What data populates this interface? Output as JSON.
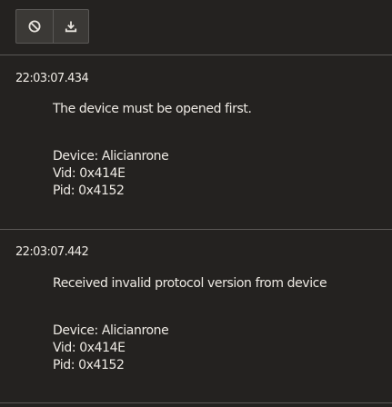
{
  "toolbar": {
    "buttons": [
      {
        "icon": "clear-icon",
        "label": ""
      },
      {
        "icon": "download-icon",
        "label": ""
      }
    ]
  },
  "entries": [
    {
      "timestamp": "22:03:07.434",
      "message": "The device must be opened first.",
      "device": "Device: Alicianrone",
      "vid": "Vid: 0x414E",
      "pid": "Pid: 0x4152"
    },
    {
      "timestamp": "22:03:07.442",
      "message": "Received invalid protocol version from device",
      "device": "Device: Alicianrone",
      "vid": "Vid: 0x414E",
      "pid": "Pid: 0x4152"
    }
  ],
  "colors": {
    "background": "#242220",
    "text": "#eeeae4",
    "divider": "#5a5755",
    "button_bg": "#3b3936",
    "icon": "#e8e4de"
  }
}
